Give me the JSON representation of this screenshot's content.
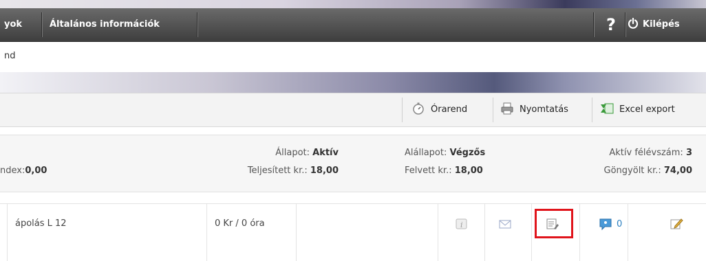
{
  "nav": {
    "items": [
      {
        "label": "yok"
      },
      {
        "label": "Általános információk"
      }
    ],
    "help_label": "?",
    "logout_label": "Kilépés"
  },
  "breadcrumb": "nd",
  "toolbar": {
    "timetable_label": "Órarend",
    "print_label": "Nyomtatás",
    "excel_label": "Excel export"
  },
  "info": {
    "index_label": "ndex:",
    "index_value": "0,00",
    "status_label": "Állapot:",
    "status_value": "Aktív",
    "completed_credits_label": "Teljesített kr.:",
    "completed_credits_value": "18,00",
    "substatus_label": "Alállapot:",
    "substatus_value": "Végzős",
    "taken_credits_label": "Felvett kr.:",
    "taken_credits_value": "18,00",
    "active_semester_label": "Aktív félévszám:",
    "active_semester_value": "3",
    "cumulative_credits_label": "Göngyölt kr.:",
    "cumulative_credits_value": "74,00"
  },
  "row": {
    "name": "ápolás L 12",
    "credits_hours": "0 Kr / 0 óra",
    "comment_count": "0"
  },
  "colors": {
    "nav_bg": "#4a4a4a",
    "highlight": "#e0141b",
    "excel_green": "#3a9a3a",
    "comment_blue": "#2a7fc0"
  },
  "icons": [
    "power-icon",
    "stopwatch-icon",
    "printer-icon",
    "excel-icon",
    "info-icon",
    "mail-icon",
    "form-icon",
    "comment-icon",
    "edit-icon"
  ]
}
